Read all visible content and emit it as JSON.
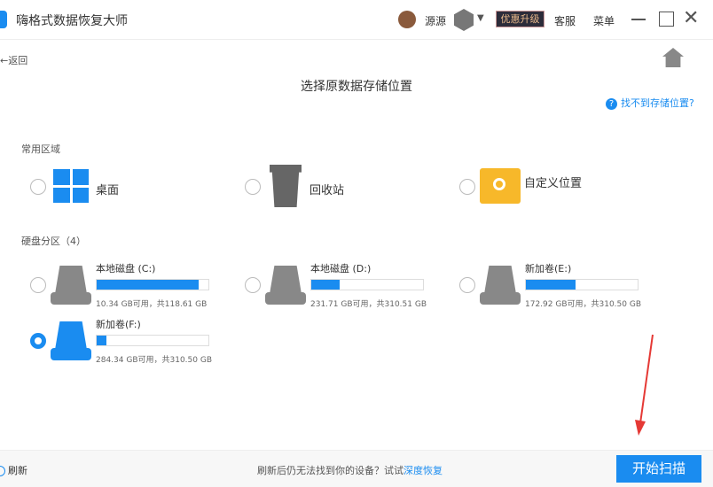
{
  "app": {
    "title": "嗨格式数据恢复大师",
    "user": "源源",
    "upgrade": "优惠升级",
    "service": "客服",
    "menu": "菜单"
  },
  "nav": {
    "back": "返回",
    "page_title": "选择原数据存储位置",
    "help": "找不到存储位置?"
  },
  "common": {
    "heading": "常用区域",
    "items": [
      {
        "label": "桌面",
        "icon": "windows-icon"
      },
      {
        "label": "回收站",
        "icon": "recycle-bin-icon"
      },
      {
        "label": "自定义位置",
        "icon": "folder-search-icon"
      }
    ]
  },
  "drives": {
    "heading": "硬盘分区（4）",
    "items": [
      {
        "name": "本地磁盘 (C:)",
        "size": "10.34 GB可用，共118.61 GB",
        "used_fraction": 0.913,
        "selected": false
      },
      {
        "name": "本地磁盘 (D:)",
        "size": "231.71 GB可用，共310.51 GB",
        "used_fraction": 0.254,
        "selected": false
      },
      {
        "name": "新加卷(E:)",
        "size": "172.92 GB可用，共310.50 GB",
        "used_fraction": 0.443,
        "selected": false
      },
      {
        "name": "新加卷(F:)",
        "size": "284.34 GB可用，共310.50 GB",
        "used_fraction": 0.084,
        "selected": true
      }
    ]
  },
  "footer": {
    "refresh": "刷新",
    "hint": "刷新后仍无法找到你的设备？试试",
    "deep": "深度恢复",
    "start": "开始扫描"
  },
  "colors": {
    "accent": "#1a8cf0",
    "annotation_arrow": "#e53935"
  }
}
